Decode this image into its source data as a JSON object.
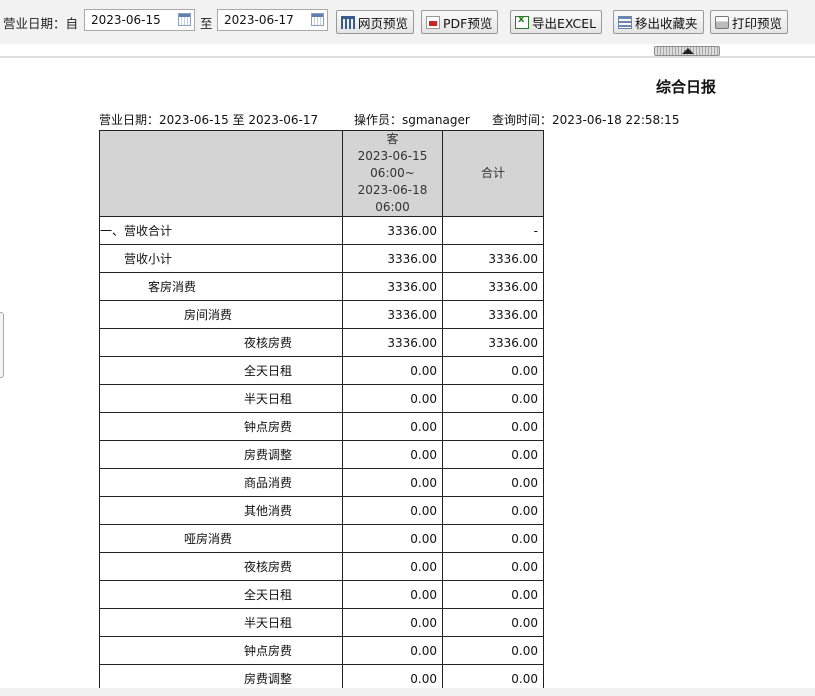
{
  "toolbar": {
    "date_label": "营业日期：自",
    "to_label": "至",
    "start_date": "2023-06-15",
    "end_date": "2023-06-17",
    "buttons": {
      "web_preview": "网页预览",
      "pdf_preview": "PDF预览",
      "export_excel": "导出EXCEL",
      "remove_favorite": "移出收藏夹",
      "print_preview": "打印预览"
    }
  },
  "report": {
    "title": "综合日报",
    "meta": {
      "date_range": "营业日期：2023-06-15  至  2023-06-17",
      "operator": "操作员：sgmanager",
      "query_time": "查询时间：2023-06-18 22:58:15"
    },
    "columns": {
      "period": [
        "客",
        "2023-06-15",
        "06:00~",
        "2023-06-18",
        "06:00"
      ],
      "total": "合计"
    },
    "rows": [
      {
        "label": "一、营收合计",
        "value": "3336.00",
        "total": "-"
      },
      {
        "label": "营收小计",
        "value": "3336.00",
        "total": "3336.00"
      },
      {
        "label": "客房消费",
        "value": "3336.00",
        "total": "3336.00"
      },
      {
        "label": "房间消费",
        "value": "3336.00",
        "total": "3336.00"
      },
      {
        "label": "夜核房费",
        "value": "3336.00",
        "total": "3336.00"
      },
      {
        "label": "全天日租",
        "value": "0.00",
        "total": "0.00"
      },
      {
        "label": "半天日租",
        "value": "0.00",
        "total": "0.00"
      },
      {
        "label": "钟点房费",
        "value": "0.00",
        "total": "0.00"
      },
      {
        "label": "房费调整",
        "value": "0.00",
        "total": "0.00"
      },
      {
        "label": "商品消费",
        "value": "0.00",
        "total": "0.00"
      },
      {
        "label": "其他消费",
        "value": "0.00",
        "total": "0.00"
      },
      {
        "label": "哑房消费",
        "value": "0.00",
        "total": "0.00"
      },
      {
        "label": "夜核房费",
        "value": "0.00",
        "total": "0.00"
      },
      {
        "label": "全天日租",
        "value": "0.00",
        "total": "0.00"
      },
      {
        "label": "半天日租",
        "value": "0.00",
        "total": "0.00"
      },
      {
        "label": "钟点房费",
        "value": "0.00",
        "total": "0.00"
      },
      {
        "label": "房费调整",
        "value": "0.00",
        "total": "0.00"
      }
    ]
  }
}
